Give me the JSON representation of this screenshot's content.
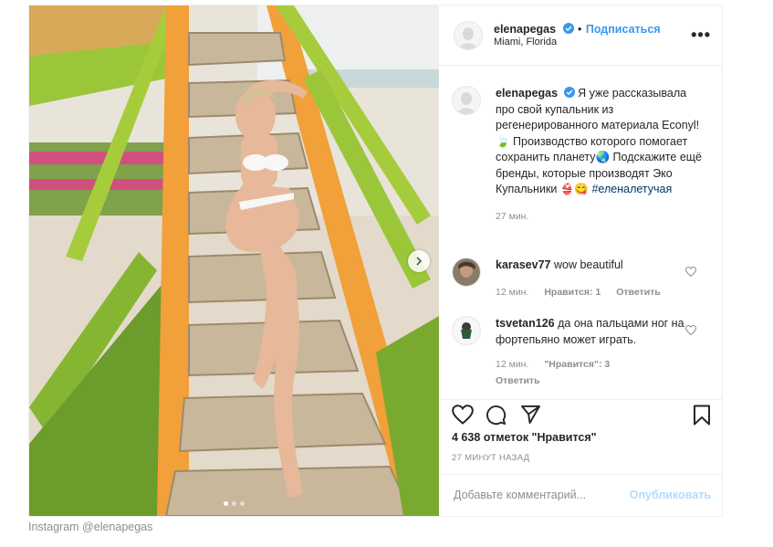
{
  "post": {
    "username": "elenapegas",
    "follow_label": "Подписаться",
    "location": "Miami, Florida",
    "more_label": "•••",
    "photo_alt": "",
    "carousel": {
      "total": 3,
      "active": 0
    }
  },
  "caption_comment": {
    "username": "elenapegas",
    "text": "Я уже рассказывала про свой купальник из регенерированного материала Econyl! 🍃 Производство которого помогает сохранить планету🌏 Подскажите ещё бренды, которые производят Эко Купальники 👙😋",
    "hashtag": "#еленалетучая",
    "time": "27 мин."
  },
  "comments": [
    {
      "username": "karasev77",
      "text": "wow beautiful",
      "time": "12 мин.",
      "likes": "Нравится: 1",
      "reply": "Ответить"
    },
    {
      "username": "tsvetan126",
      "text": "да она пальцами ног на фортепьяно может играть.",
      "time": "12 мин.",
      "likes": "\"Нравится\": 3",
      "reply": "Ответить"
    }
  ],
  "footer": {
    "likes_count": "4 638 отметок \"Нравится\"",
    "time_ago": "27 МИНУТ НАЗАД",
    "comment_placeholder": "Добавьте комментарий...",
    "publish_label": "Опубликовать"
  },
  "page_caption": "Instagram @elenapegas",
  "colors": {
    "accent": "#3897f0",
    "verified": "#3897f0",
    "text": "#262626",
    "muted": "#8e8e8e",
    "publish_disabled": "#b3dbff"
  },
  "icons": [
    "chevron-right-icon",
    "verified-icon",
    "heart-icon",
    "comment-icon",
    "share-icon",
    "bookmark-icon"
  ]
}
